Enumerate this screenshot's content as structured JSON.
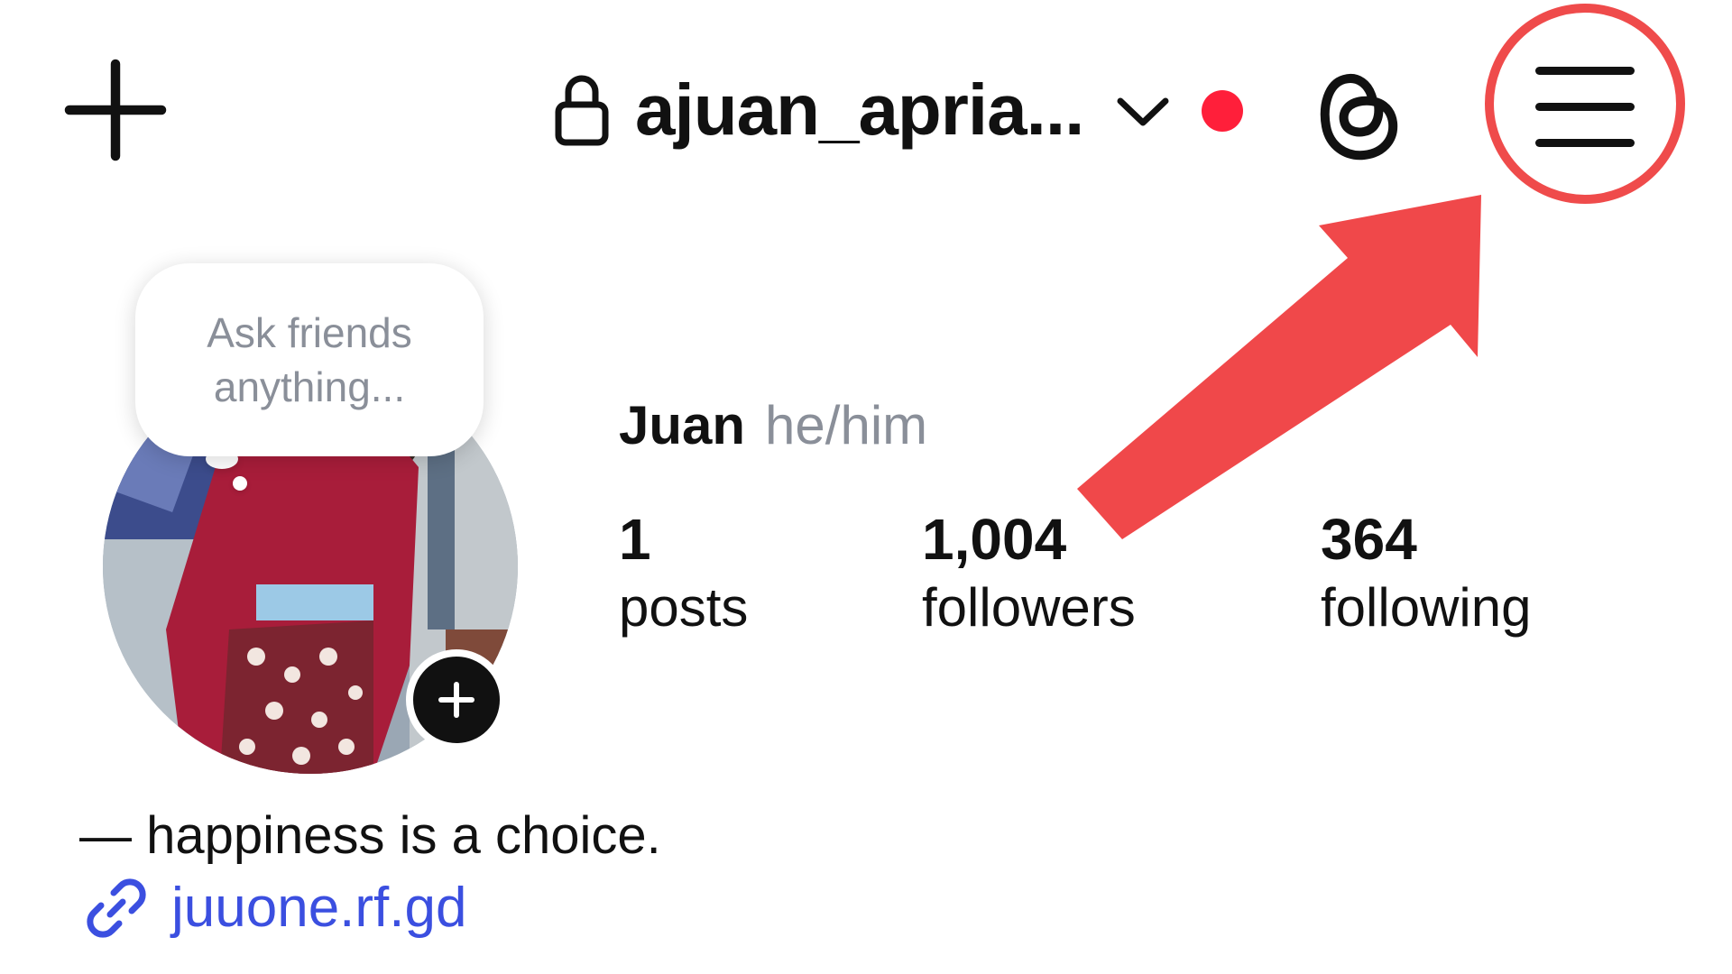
{
  "header": {
    "username": "ajuan_apria...",
    "create_icon": "plus-icon",
    "lock_icon": "lock-icon",
    "switch_account_icon": "chevron-down-icon",
    "notification_dot_color": "#ff1f3a",
    "threads_icon": "threads-icon",
    "menu_icon": "hamburger-menu-icon"
  },
  "annotation": {
    "color": "#ef4b4b",
    "highlight_shape": "circle",
    "arrow_icon": "red-arrow-icon"
  },
  "profile": {
    "note": "Ask friends anything...",
    "display_name": "Juan",
    "pronouns": "he/him",
    "stats": {
      "posts": {
        "value": "1",
        "label": "posts"
      },
      "followers": {
        "value": "1,004",
        "label": "followers"
      },
      "following": {
        "value": "364",
        "label": "following"
      }
    },
    "bio": "— happiness is a choice.",
    "link": "juuone.rf.gd",
    "link_color": "#3b4fe0"
  }
}
